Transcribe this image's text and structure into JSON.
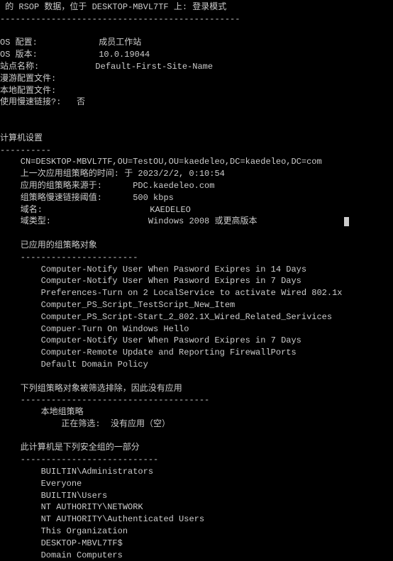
{
  "header": {
    "title": " 的 RSOP 数据，位于 DESKTOP-MBVL7TF 上: 登录模式",
    "divider": "-----------------------------------------------"
  },
  "os_config": {
    "label": "OS 配置:",
    "value": "成员工作站"
  },
  "os_version": {
    "label": "OS 版本:",
    "value": "10.0.19044"
  },
  "site_name": {
    "label": "站点名称:",
    "value": "Default-First-Site-Name"
  },
  "roaming_profile": {
    "label": "漫游配置文件:"
  },
  "local_profile": {
    "label": "本地配置文件:"
  },
  "slow_link": {
    "label": "使用慢速链接?:",
    "value": "否"
  },
  "computer_settings": {
    "title": "计算机设置",
    "divider": "----------",
    "cn": "    CN=DESKTOP-MBVL7TF,OU=TestOU,OU=kaedeleo,DC=kaedeleo,DC=com",
    "last_applied": {
      "label": "    上一次应用组策略的时间:",
      "value": "于 2023/2/2, 0:10:54"
    },
    "policy_source": {
      "label": "    应用的组策略来源于:",
      "value": "PDC.kaedeleo.com"
    },
    "threshold": {
      "label": "    组策略慢速链接阈值:",
      "value": "500 kbps"
    },
    "domain_name": {
      "label": "    域名:",
      "value": "KAEDELEO"
    },
    "domain_type": {
      "label": "    域类型:",
      "value": "Windows 2008 或更高版本"
    }
  },
  "applied_gpos": {
    "title": "    已应用的组策略对象",
    "divider": "    -----------------------",
    "items": [
      "        Computer-Notify User When Pasword Exipres in 14 Days",
      "        Computer-Notify User When Pasword Exipres in 7 Days",
      "        Preferences-Turn on 2 LocalService to activate Wired 802.1x",
      "        Computer_PS_Script_TestScript_New_Item",
      "        Computer_PS_Script-Start_2_802.1X_Wired_Related_Serivices",
      "        Compuer-Turn On Windows Hello",
      "        Computer-Notify User When Pasword Exipres in 7 Days",
      "        Computer-Remote Update and Reporting FirewallPorts",
      "        Default Domain Policy"
    ]
  },
  "filtered_gpos": {
    "title": "    下列组策略对象被筛选排除，因此没有应用",
    "divider": "    -------------------------------------",
    "local_policy": "        本地组策略",
    "filtering": {
      "label": "            正在筛选:",
      "value": "  没有应用（空）"
    }
  },
  "security_groups": {
    "title": "    此计算机是下列安全组的一部分",
    "divider": "    ---------------------------",
    "items": [
      "        BUILTIN\\Administrators",
      "        Everyone",
      "        BUILTIN\\Users",
      "        NT AUTHORITY\\NETWORK",
      "        NT AUTHORITY\\Authenticated Users",
      "        This Organization",
      "        DESKTOP-MBVL7TF$",
      "        Domain Computers"
    ]
  }
}
